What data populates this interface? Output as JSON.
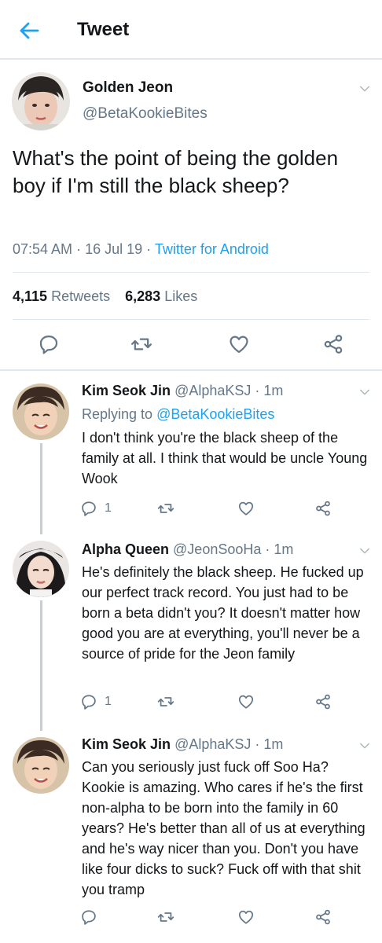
{
  "header": {
    "title": "Tweet"
  },
  "tweet": {
    "name": "Golden Jeon",
    "handle": "@BetaKookieBites",
    "text": "What's the point of being the golden boy if I'm still the black sheep?",
    "time": "07:54 AM",
    "date": "16 Jul 19",
    "source": "Twitter for Android",
    "separator": "·",
    "retweets_count": "4,115",
    "retweets_label": "Retweets",
    "likes_count": "6,283",
    "likes_label": "Likes"
  },
  "replies": [
    {
      "name": "Kim Seok Jin",
      "handle": "@AlphaKSJ",
      "time": "1m",
      "replying_prefix": "Replying to",
      "replying_handle": "@BetaKookieBites",
      "text": "I don't think you're the black sheep of the family at all. I think that would be uncle Young Wook",
      "reply_count": "1"
    },
    {
      "name": "Alpha Queen",
      "handle": "@JeonSooHa",
      "time": "1m",
      "text": "He's definitely the black sheep. He fucked up our perfect track record. You just had to be born a beta didn't you? It doesn't matter how good you are at everything, you'll never be a source of pride for the Jeon family",
      "reply_count": "1"
    },
    {
      "name": "Kim Seok Jin",
      "handle": "@AlphaKSJ",
      "time": "1m",
      "text": "Can you seriously just fuck off Soo Ha? Kookie is amazing. Who cares if he's the first non-alpha to be born into the family in 60 years? He's better than all of us at everything and he's way nicer than you. Don't you have like four dicks to suck? Fuck off with that shit you tramp",
      "reply_count": ""
    }
  ],
  "colors": {
    "accent": "#1da1f2",
    "secondary": "#657786",
    "text": "#14171a",
    "divider": "#e1e8ed"
  },
  "icons": [
    "back-arrow-icon",
    "chevron-down-icon",
    "reply-icon",
    "retweet-icon",
    "like-icon",
    "share-icon"
  ]
}
